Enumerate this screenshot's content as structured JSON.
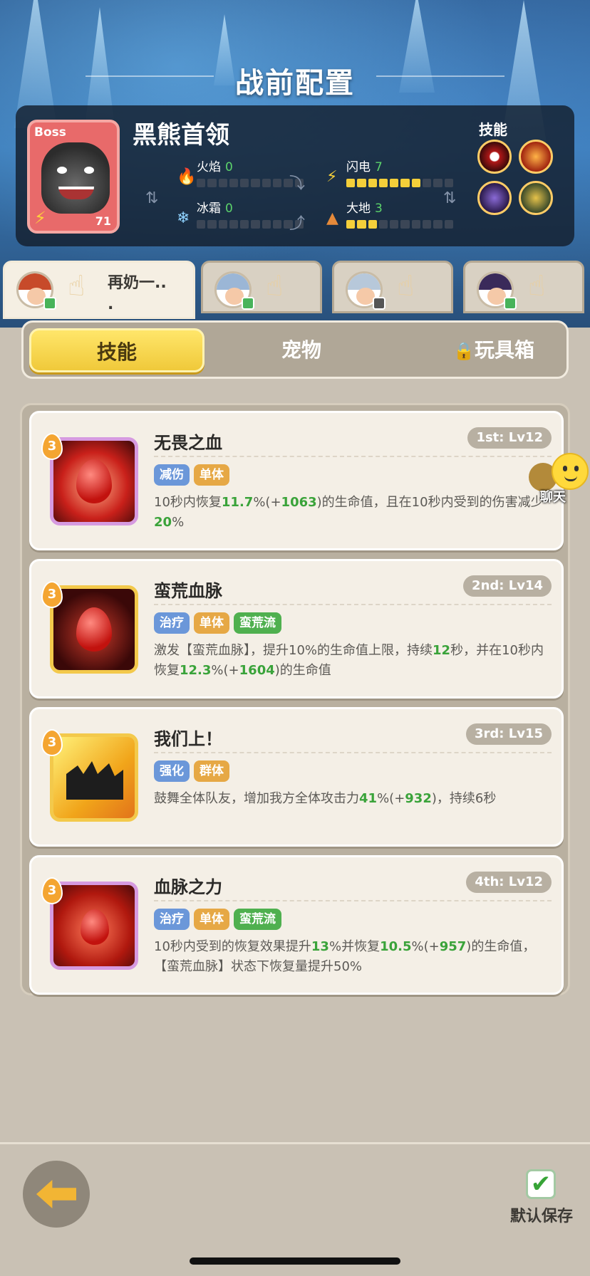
{
  "header": {
    "title": "战前配置"
  },
  "boss": {
    "tag": "Boss",
    "name": "黑熊首领",
    "level": "71",
    "stats": {
      "fire": {
        "label": "火焰",
        "value": "0",
        "filled": 0
      },
      "lightning": {
        "label": "闪电",
        "value": "7",
        "filled": 7
      },
      "frost": {
        "label": "冰霜",
        "value": "0",
        "filled": 0
      },
      "earth": {
        "label": "大地",
        "value": "3",
        "filled": 3
      }
    },
    "skills_label": "技能"
  },
  "heroes": [
    {
      "name": "再奶一..\n.",
      "hair_color": "#c74a2a"
    },
    {
      "name": "",
      "hair_color": "#9bb6d6"
    },
    {
      "name": "",
      "hair_color": "#b7c8da"
    },
    {
      "name": "",
      "hair_color": "#3a2a5a"
    }
  ],
  "segment": {
    "skills": "技能",
    "pets": "宠物",
    "toybox": "玩具箱"
  },
  "skills": [
    {
      "title": "无畏之血",
      "rank": "1st: Lv12",
      "tier": "3",
      "tags": [
        {
          "text": "减伤",
          "color": "blue"
        },
        {
          "text": "单体",
          "color": "orange"
        }
      ],
      "desc": [
        {
          "t": "10秒内恢复"
        },
        {
          "t": "11.7",
          "g": true
        },
        {
          "t": "%(+"
        },
        {
          "t": "1063",
          "g": true
        },
        {
          "t": ")的生命值，且在10秒内受到的伤害减少"
        },
        {
          "t": "20",
          "g": true
        },
        {
          "t": "%"
        }
      ]
    },
    {
      "title": "蛮荒血脉",
      "rank": "2nd: Lv14",
      "tier": "3",
      "tags": [
        {
          "text": "治疗",
          "color": "blue"
        },
        {
          "text": "单体",
          "color": "orange"
        },
        {
          "text": "蛮荒流",
          "color": "green"
        }
      ],
      "desc": [
        {
          "t": "激发【蛮荒血脉】，提升10%的生命值上限，持续"
        },
        {
          "t": "12",
          "g": true
        },
        {
          "t": "秒，并在10秒内恢复"
        },
        {
          "t": "12.3",
          "g": true
        },
        {
          "t": "%(+"
        },
        {
          "t": "1604",
          "g": true
        },
        {
          "t": ")的生命值"
        }
      ]
    },
    {
      "title": "我们上！",
      "rank": "3rd: Lv15",
      "tier": "3",
      "tags": [
        {
          "text": "强化",
          "color": "blue"
        },
        {
          "text": "群体",
          "color": "orange"
        }
      ],
      "desc": [
        {
          "t": "鼓舞全体队友，增加我方全体攻击力"
        },
        {
          "t": "41",
          "g": true
        },
        {
          "t": "%(+"
        },
        {
          "t": "932",
          "g": true
        },
        {
          "t": ")，持续6秒"
        }
      ]
    },
    {
      "title": "血脉之力",
      "rank": "4th: Lv12",
      "tier": "3",
      "tags": [
        {
          "text": "治疗",
          "color": "blue"
        },
        {
          "text": "单体",
          "color": "orange"
        },
        {
          "text": "蛮荒流",
          "color": "green"
        }
      ],
      "desc": [
        {
          "t": "10秒内受到的恢复效果提升"
        },
        {
          "t": "13",
          "g": true
        },
        {
          "t": "%并恢复"
        },
        {
          "t": "10.5",
          "g": true
        },
        {
          "t": "%(+"
        },
        {
          "t": "957",
          "g": true
        },
        {
          "t": ")的生命值，【蛮荒血脉】状态下恢复量提升50%"
        }
      ]
    }
  ],
  "chat": {
    "label": "聊天"
  },
  "footer": {
    "save_label": "默认保存"
  }
}
